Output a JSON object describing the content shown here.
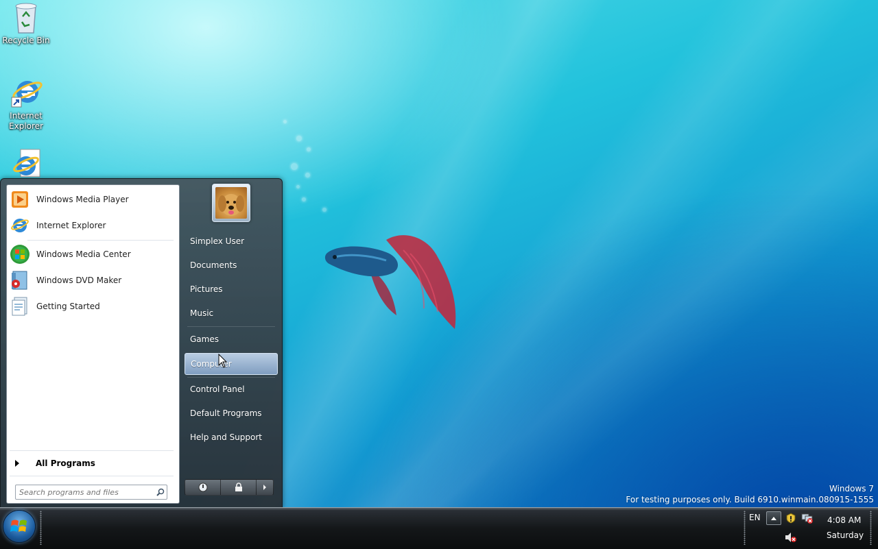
{
  "desktop": {
    "icons": [
      {
        "label": "Recycle Bin"
      },
      {
        "label": "Internet Explorer"
      }
    ],
    "watermark": {
      "line1": "Windows 7",
      "line2": "For testing purposes only. Build 6910.winmain.080915-1555"
    }
  },
  "start_menu": {
    "programs": [
      {
        "label": "Windows Media Player",
        "icon": "media-player-icon"
      },
      {
        "label": "Internet Explorer",
        "icon": "internet-explorer-icon"
      },
      {
        "label": "Windows Media Center",
        "icon": "media-center-icon"
      },
      {
        "label": "Windows DVD Maker",
        "icon": "dvd-maker-icon"
      },
      {
        "label": "Getting Started",
        "icon": "getting-started-icon"
      }
    ],
    "all_programs": "All Programs",
    "search_placeholder": "Search programs and files",
    "right_items": [
      {
        "label": "Simplex User"
      },
      {
        "label": "Documents"
      },
      {
        "label": "Pictures"
      },
      {
        "label": "Music"
      },
      {
        "label": "Games"
      },
      {
        "label": "Computer",
        "highlighted": true
      },
      {
        "label": "Control Panel"
      },
      {
        "label": "Default Programs"
      },
      {
        "label": "Help and Support"
      }
    ],
    "power_icons": [
      "power-icon",
      "lock-icon",
      "arrow-right-icon"
    ]
  },
  "taskbar": {
    "language": "EN",
    "time": "4:08 AM",
    "day": "Saturday",
    "tray_icons": [
      "show-hidden-icons-icon",
      "action-center-icon",
      "network-icon",
      "volume-muted-icon"
    ]
  },
  "colors": {
    "highlight": "#8fabcd",
    "taskbar": "#141719",
    "accent": "#1c5c9e"
  }
}
